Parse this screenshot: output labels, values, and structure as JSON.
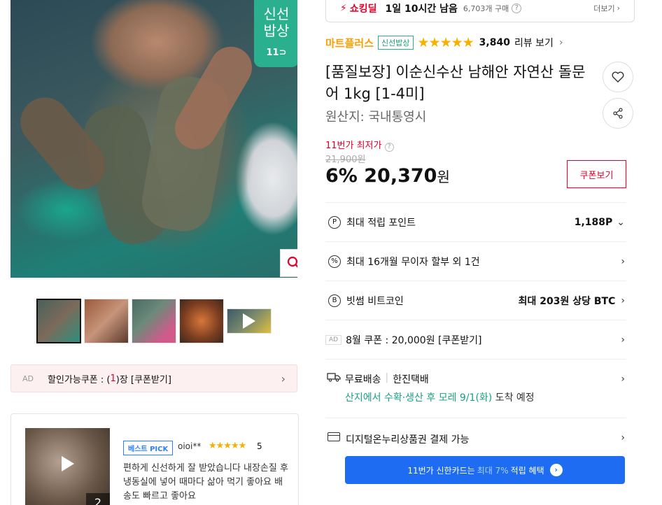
{
  "main_image": {
    "badge_line1": "신선",
    "badge_line2": "밥상",
    "badge_brand": "11⊃"
  },
  "thumbnails": [
    {
      "name": "thumb-1"
    },
    {
      "name": "thumb-2"
    },
    {
      "name": "thumb-3"
    },
    {
      "name": "thumb-4"
    },
    {
      "name": "thumb-5-video"
    }
  ],
  "left_ad": {
    "ad": "AD",
    "prefix": "할인가능쿠폰 : (",
    "count": "1",
    "suffix": ")장 [쿠폰받기]"
  },
  "review": {
    "image_count": "2",
    "badge": "베스트 PICK",
    "reviewer": "oioi**",
    "stars": "★★★★★",
    "score": "5",
    "text": "편하게 신선하게 잘 받았습니다 내장손질 후 냉동실에 넣어 때마다 삶아 먹기 좋아요 배송도 빠르고 좋아요"
  },
  "deal": {
    "label": "쇼킹딜",
    "time": "1일 10시간 남음",
    "buy_count": "6,703개 구매",
    "more": "더보기"
  },
  "seller": {
    "name": "마트플러스",
    "tag": "신선밥상",
    "stars": "★★★★★",
    "rating": 4.5,
    "review_count": "3,840",
    "review_link": "리뷰 보기"
  },
  "product": {
    "title": "[품질보장] 이순신수산 남해안 자연산 돌문어 1kg [1-4미]",
    "origin": "원산지:  국내통영시"
  },
  "price": {
    "lowest_label": "11번가 최저가",
    "original": "21,900원",
    "discount": "6%",
    "amount": "20,370",
    "won": "원",
    "coupon_button": "쿠폰보기"
  },
  "benefits": {
    "points_label": "최대 적립 포인트",
    "points_value": "1,188P",
    "installment_label": "최대 16개월 무이자 할부 외 1건",
    "bitcoin_label": "빗썸 비트코인",
    "bitcoin_value": "최대 203원 상당 BTC",
    "coupon_ad": "AD",
    "coupon_label": "8월 쿠폰 : 20,000원 [쿠폰받기]",
    "shipping_label": "무료배송",
    "shipping_carrier": "한진택배",
    "shipping_eta": "산지에서 수확·생산 후 모레 9/1(화)",
    "shipping_eta_suffix": "도착 예정",
    "digital_label": "디지털온누리상품권 결제 가능"
  },
  "shinhan_banner": {
    "prefix": "11번가 신한카드는",
    "highlight": "최대 7%",
    "suffix": "적립 혜택"
  },
  "colors": {
    "brand_red": "#e8002a",
    "seller_orange": "#ff9d00",
    "fresh_green": "#2bb08f",
    "banner_blue": "#1d6cf2",
    "star_yellow": "#f5b000"
  }
}
